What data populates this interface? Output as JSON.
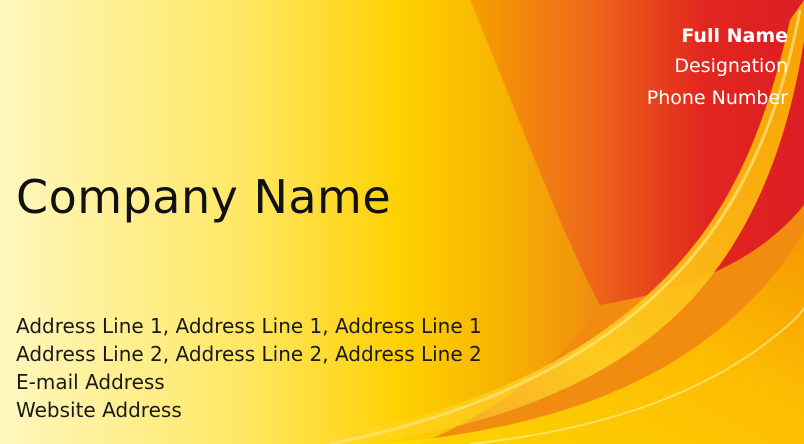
{
  "card": {
    "full_name": "Full Name",
    "designation": "Designation",
    "phone": "Phone Number",
    "company_name": "Company Name",
    "address_line_1": "Address Line 1,  Address Line 1,  Address Line 1",
    "address_line_2": "Address Line 2,  Address Line 2,  Address Line 2",
    "email": "E-mail Address",
    "website": "Website Address"
  },
  "colors": {
    "background_light": "#fff4b0",
    "background_yellow": "#ffd400",
    "background_orange": "#f39200",
    "background_red": "#e52520",
    "company_text": "#111111",
    "contact_text": "#ffffff"
  }
}
